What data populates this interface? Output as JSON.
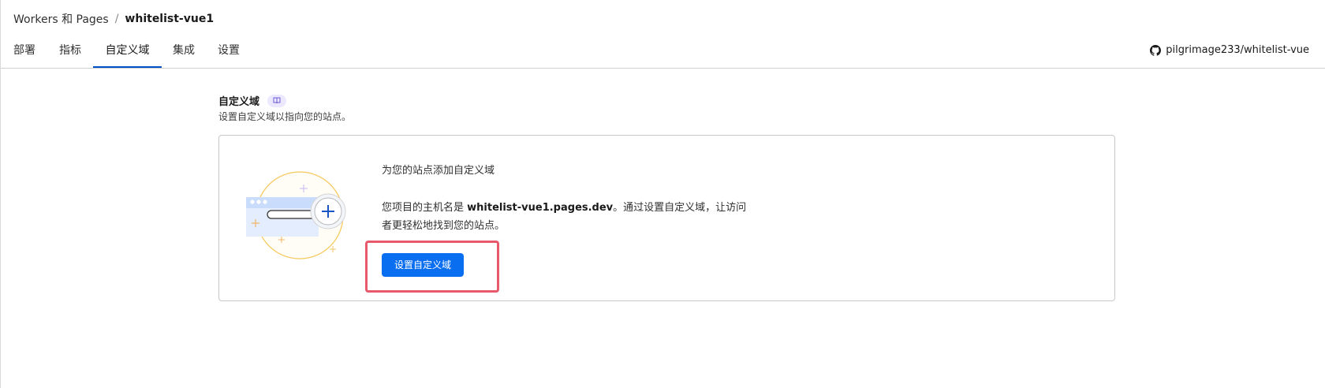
{
  "breadcrumb": {
    "parent": "Workers 和 Pages",
    "separator": "/",
    "current": "whitelist-vue1"
  },
  "tabs": [
    {
      "label": "部署",
      "active": false
    },
    {
      "label": "指标",
      "active": false
    },
    {
      "label": "自定义域",
      "active": true
    },
    {
      "label": "集成",
      "active": false
    },
    {
      "label": "设置",
      "active": false
    }
  ],
  "repo": {
    "icon": "github-icon",
    "label": "pilgrimage233/whitelist-vue"
  },
  "section": {
    "title": "自定义域",
    "badge_icon": "book-icon",
    "description": "设置自定义域以指向您的站点。"
  },
  "card": {
    "heading": "为您的站点添加自定义域",
    "body_prefix": "您项目的主机名是 ",
    "hostname": "whitelist-vue1.pages.dev",
    "body_suffix": "。通过设置自定义域，让访问者更轻松地找到您的站点。",
    "button_label": "设置自定义域",
    "illustration_icon": "browser-add-domain-icon"
  },
  "colors": {
    "primary": "#0a6ef0",
    "tab_active": "#0051c3",
    "highlight": "#e8596b",
    "illustration_circle": "#f6c75b"
  }
}
